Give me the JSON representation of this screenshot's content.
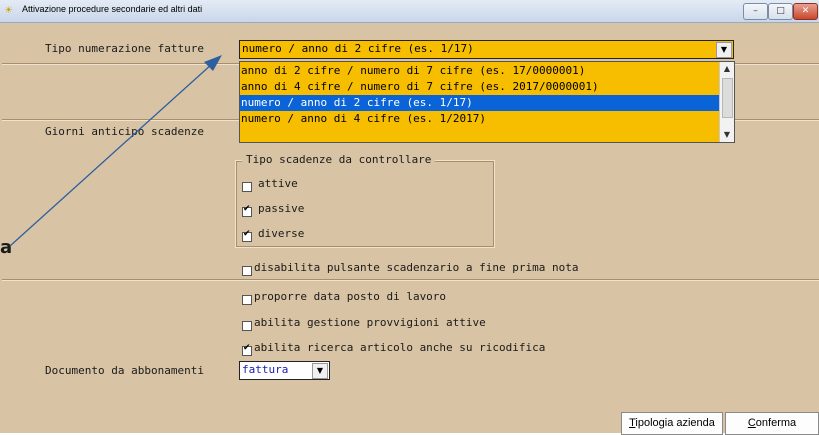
{
  "window": {
    "title": "Attivazione procedure secondarie ed altri dati",
    "buttons": {
      "minimize": "–",
      "maximize": "□",
      "close": "✕"
    }
  },
  "invoice_numbering": {
    "label": "Tipo numerazione fatture",
    "selected": "numero / anno di 2 cifre (es. 1/17)",
    "options": [
      "anno di 2 cifre / numero di 7 cifre (es. 17/0000001)",
      "anno di 4 cifre / numero di 7 cifre (es. 2017/0000001)",
      "numero / anno di 2 cifre (es. 1/17)",
      "numero / anno di 4 cifre (es. 1/2017)"
    ],
    "highlighted_index": 2
  },
  "due_days": {
    "label": "Giorni anticipo scadenze"
  },
  "due_types": {
    "title": "Tipo scadenze da controllare",
    "items": [
      {
        "label": "attive",
        "checked": false
      },
      {
        "label": "passive",
        "checked": true
      },
      {
        "label": "diverse",
        "checked": true
      }
    ]
  },
  "options": [
    {
      "label": "disabilita pulsante scadenzario a fine prima nota",
      "checked": false
    },
    {
      "label": "proporre data posto di lavoro",
      "checked": false
    },
    {
      "label": "abilita gestione provvigioni attive",
      "checked": false
    },
    {
      "label": "abilita ricerca articolo anche su ricodifica",
      "checked": true
    }
  ],
  "subscriptions_doc": {
    "label": "Documento da abbonamenti",
    "value": "fattura"
  },
  "annotation": {
    "letter": "a"
  },
  "footer": {
    "tipologia_first": "T",
    "tipologia_rest": "ipologia azienda",
    "conferma_first": "C",
    "conferma_rest": "onferma"
  },
  "colors": {
    "background": "#d8c4a4",
    "combo": "#f7be00",
    "selection": "#0a64d8",
    "arrow": "#2e5fa0"
  }
}
